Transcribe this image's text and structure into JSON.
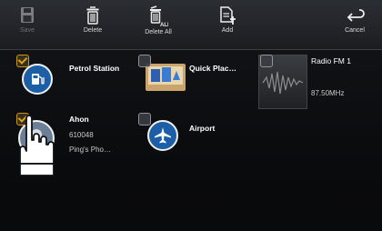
{
  "toolbar": {
    "save_label": "Save",
    "delete_label": "Delete",
    "delete_all_label": "Delete All",
    "add_label": "Add",
    "cancel_label": "Cancel"
  },
  "favorites": {
    "petrol": {
      "title": "Petrol Station",
      "checked": true
    },
    "quick": {
      "title": "Quick Plac…",
      "checked": false
    },
    "radio": {
      "title": "Radio FM 1",
      "freq": "87.50MHz",
      "checked": false
    },
    "contact": {
      "title": "Ahon",
      "number": "610048",
      "phone": "Ping's Pho…",
      "checked": true
    },
    "airport": {
      "title": "Airport",
      "checked": false
    }
  },
  "colors": {
    "accent": "#e6a21a",
    "icon_blue": "#1d5fa6"
  }
}
